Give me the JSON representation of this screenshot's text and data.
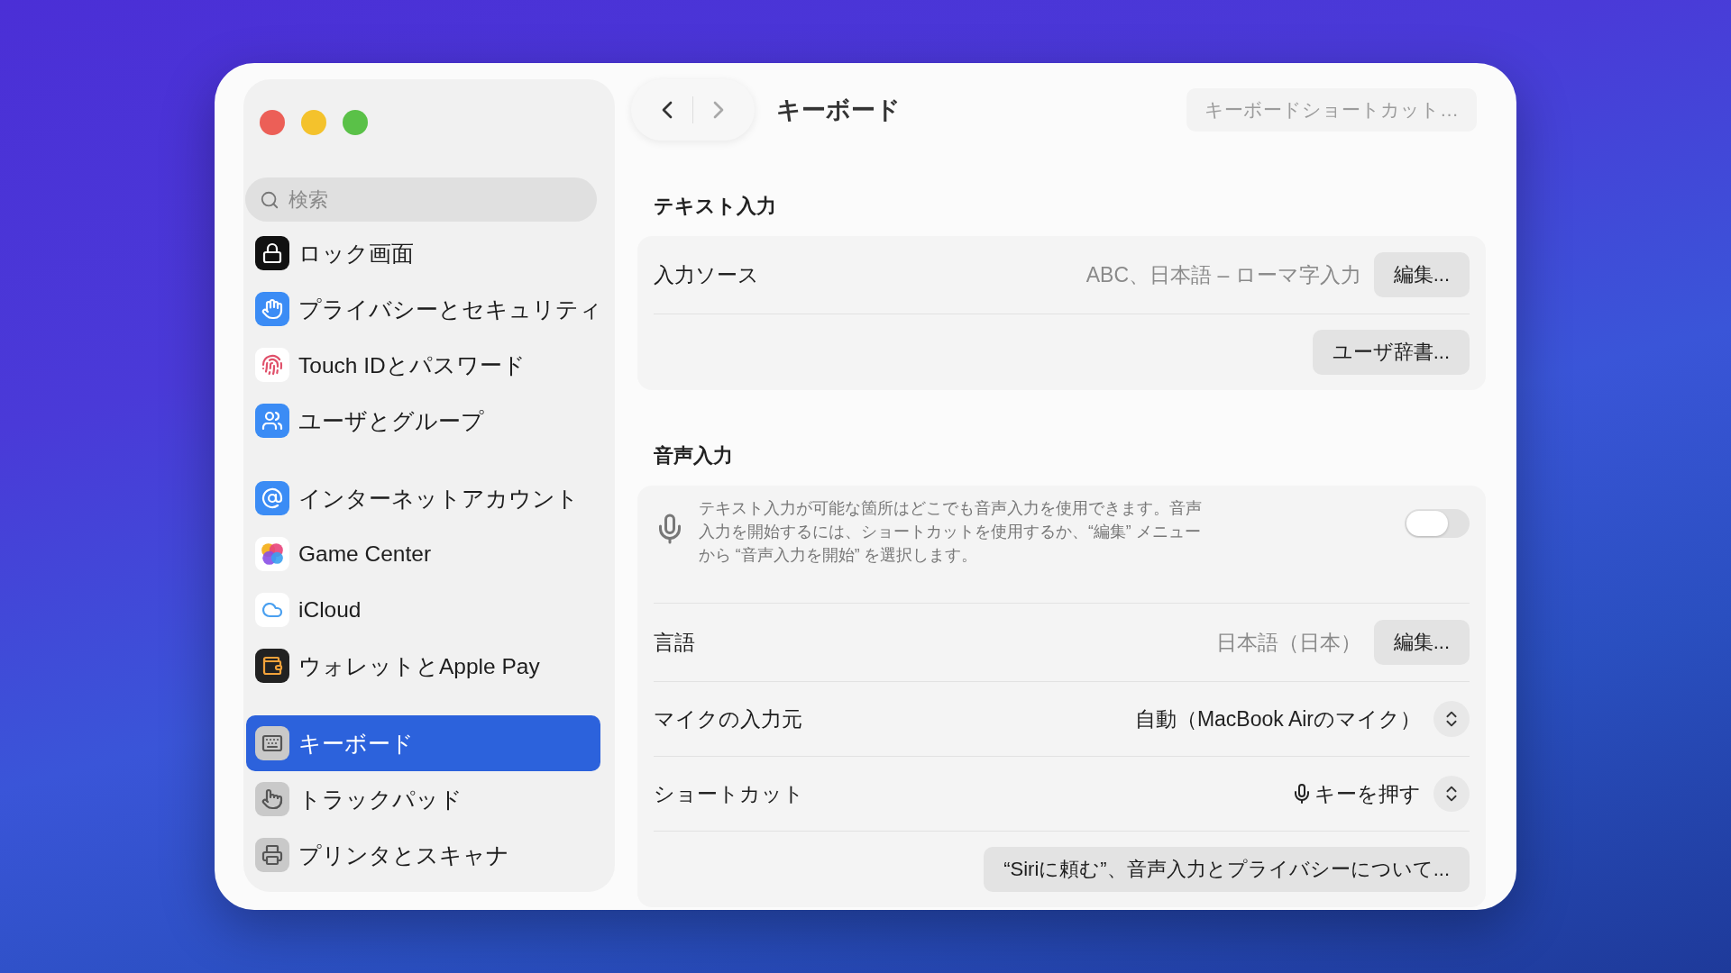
{
  "window": {
    "title": "キーボード",
    "toolbar_button": "キーボードショートカット…"
  },
  "nav": {
    "back_disabled": false,
    "forward_disabled": true
  },
  "search": {
    "placeholder": "検索"
  },
  "sidebar": {
    "groups": [
      [
        {
          "label": "ロック画面",
          "selected": false
        },
        {
          "label": "プライバシーとセキュリティ",
          "selected": false
        },
        {
          "label": "Touch IDとパスワード",
          "selected": false
        },
        {
          "label": "ユーザとグループ",
          "selected": false
        }
      ],
      [
        {
          "label": "インターネットアカウント",
          "selected": false
        },
        {
          "label": "Game Center",
          "selected": false
        },
        {
          "label": "iCloud",
          "selected": false
        },
        {
          "label": "ウォレットとApple Pay",
          "selected": false
        }
      ],
      [
        {
          "label": "キーボード",
          "selected": true
        },
        {
          "label": "トラックパッド",
          "selected": false
        },
        {
          "label": "プリンタとスキャナ",
          "selected": false
        }
      ]
    ]
  },
  "sections": [
    {
      "title": "テキスト入力",
      "rows": [
        {
          "kind": "value_button",
          "label": "入力ソース",
          "value": "ABC、日本語 – ローマ字入力",
          "button": "編集..."
        },
        {
          "kind": "button",
          "button": "ユーザ辞書..."
        }
      ]
    },
    {
      "title": "音声入力",
      "rows": [
        {
          "kind": "toggle",
          "text": "テキスト入力が可能な箇所はどこでも音声入力を使用できます。音声入力を開始するには、ショートカットを使用するか、“編集” メニューから “音声入力を開始” を選択します。",
          "on": false
        },
        {
          "kind": "value_button",
          "label": "言語",
          "value": "日本語（日本）",
          "button": "編集..."
        },
        {
          "kind": "popup",
          "label": "マイクの入力元",
          "value": "自動（MacBook Airのマイク）"
        },
        {
          "kind": "mic_popup",
          "label": "ショートカット",
          "value": "キーを押す"
        },
        {
          "kind": "button",
          "button": "“Siriに頼む”、音声入力とプライバシーについて..."
        }
      ]
    }
  ]
}
